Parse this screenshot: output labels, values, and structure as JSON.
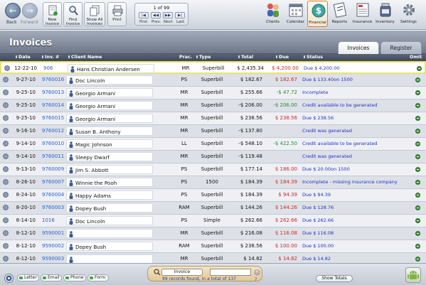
{
  "toolbar": {
    "back_label": "Back",
    "forward_label": "Forward",
    "new_invoice_label": "New\nInvoice",
    "find_invoice_label": "Find\nInvoice",
    "show_all_label": "Show All\nInvoices",
    "print_label": "Print",
    "record_nav": {
      "count": "1 of 99",
      "first_label": "First",
      "prev_label": "Prev.",
      "next_label": "Next",
      "last_label": "Last"
    },
    "modules": [
      {
        "label": "Clients",
        "icon": "clients-icon",
        "active": false
      },
      {
        "label": "Calendar",
        "icon": "calendar-icon",
        "active": false
      },
      {
        "label": "Financial",
        "icon": "dollar-icon",
        "active": true
      },
      {
        "label": "Reports",
        "icon": "reports-icon",
        "active": false
      },
      {
        "label": "Insurance",
        "icon": "insurance-icon",
        "active": false
      },
      {
        "label": "Inventory",
        "icon": "inventory-icon",
        "active": false
      },
      {
        "label": "Settings",
        "icon": "gear-icon",
        "active": false
      }
    ]
  },
  "header": {
    "title": "Invoices",
    "tabs": [
      {
        "label": "Invoices",
        "active": true
      },
      {
        "label": "Register",
        "active": false
      }
    ]
  },
  "table": {
    "columns": {
      "date": "Date",
      "inv": "Inv. #",
      "client": "Client Name",
      "prac": "Prac.",
      "type": "Type",
      "total": "Total",
      "due": "Due",
      "status": "Status",
      "omit": "Omit"
    },
    "rows": [
      {
        "date": "12-22-10",
        "inv": "906",
        "client": "Hans Christian Andersen",
        "prac": "MR",
        "type": "Superbill",
        "total": "$ 2,435.34",
        "due": "$ 4,200.00",
        "due_color": "#cc2a2a",
        "status": "Due $ 4,200.00"
      },
      {
        "date": "9-27-10",
        "inv": "9760016",
        "client": "Doc Lincoln",
        "prac": "PS",
        "type": "Superbill",
        "total": "$ 182.67",
        "due": "$ 182.67",
        "due_color": "#cc2a2a",
        "status": "Due $ 133.40on 1500"
      },
      {
        "date": "9-25-10",
        "inv": "9760013",
        "client": "Georgio Armani",
        "prac": "MR",
        "type": "Superbill",
        "total": "$ 255.66",
        "due": "-$ 47.72",
        "due_color": "#2d8a2d",
        "status": "Incomplete"
      },
      {
        "date": "9-25-10",
        "inv": "9760014",
        "client": "Georgio Armani",
        "prac": "MR",
        "type": "Superbill",
        "total": "-$ 206.00",
        "due": "-$ 206.00",
        "due_color": "#2d8a2d",
        "status": "Credit available to be generated"
      },
      {
        "date": "9-25-10",
        "inv": "9760015",
        "client": "Georgio Armani",
        "prac": "MR",
        "type": "Superbill",
        "total": "$ 238.56",
        "due": "$ 238.56",
        "due_color": "#cc2a2a",
        "status": "Due $ 238.56"
      },
      {
        "date": "9-16-10",
        "inv": "9760012",
        "client": "Susan B. Anthony",
        "prac": "MR",
        "type": "Superbill",
        "total": "-$ 137.80",
        "due": "",
        "due_color": "#cc2a2a",
        "status": "Credit was generated"
      },
      {
        "date": "9-14-10",
        "inv": "9760010",
        "client": "Magic Johnson",
        "prac": "LL",
        "type": "Superbill",
        "total": "-$ 548.10",
        "due": "-$ 422.50",
        "due_color": "#2d8a2d",
        "status": "Credit available to be generated"
      },
      {
        "date": "9-14-10",
        "inv": "9760011",
        "client": "Sleepy Dwarf",
        "prac": "MR",
        "type": "Superbill",
        "total": "-$ 119.48",
        "due": "",
        "due_color": "#cc2a2a",
        "status": "Credit was generated"
      },
      {
        "date": "9-13-10",
        "inv": "9760009",
        "client": "Jim S. Abbott",
        "prac": "PS",
        "type": "Superbill",
        "total": "$ 177.14",
        "due": "$ 186.00",
        "due_color": "#cc2a2a",
        "status": "Due $ 20.00on 1500"
      },
      {
        "date": "8-26-10",
        "inv": "9760007",
        "client": "Winnie the Pooh",
        "prac": "PS",
        "type": "1500",
        "total": "$ 184.39",
        "due": "$ 184.39",
        "due_color": "#cc2a2a",
        "status": "Incomplete - missing insurance company"
      },
      {
        "date": "8-24-10",
        "inv": "9760004",
        "client": "Happy Adams",
        "prac": "PS",
        "type": "Superbill",
        "total": "$ 184.39",
        "due": "$ 94.39",
        "due_color": "#cc2a2a",
        "status": "Due $ 94.39"
      },
      {
        "date": "8-20-10",
        "inv": "9760003",
        "client": "Dopey Bush",
        "prac": "RAM",
        "type": "Superbill",
        "total": "$ 144.26",
        "due": "$ 144.26",
        "due_color": "#cc2a2a",
        "status": "Due $ 128.76"
      },
      {
        "date": "8-14-10",
        "inv": "1016",
        "client": "Doc Lincoln",
        "prac": "PS",
        "type": "Simple",
        "total": "$ 262.66",
        "due": "$ 262.66",
        "due_color": "#cc2a2a",
        "status": "Due $ 262.66"
      },
      {
        "date": "8-12-10",
        "inv": "9590001",
        "client": "",
        "prac": "MR",
        "type": "Superbill",
        "total": "$ 216.08",
        "due": "$ 116.08",
        "due_color": "#cc2a2a",
        "status": "Due $ 116.08"
      },
      {
        "date": "8-12-10",
        "inv": "9590002",
        "client": "Dopey Bush",
        "prac": "RAM",
        "type": "Superbill",
        "total": "$ 238.56",
        "due": "$ 100.00",
        "due_color": "#cc2a2a",
        "status": "Due $ 100.00"
      },
      {
        "date": "8-12-10",
        "inv": "9590003",
        "client": "",
        "prac": "MR",
        "type": "Superbill",
        "total": "$ 14.82",
        "due": "$ 14.82",
        "due_color": "#cc2a2a",
        "status": "Due $ 14.82"
      }
    ]
  },
  "footer": {
    "comm_buttons": [
      "Letter",
      "Email",
      "Phone",
      "Form"
    ],
    "search_target": "Invoice",
    "search_value": "",
    "records_found": "99 records found, in a total of 137",
    "help_label": "?",
    "show_totals_label": "Show Totals"
  }
}
